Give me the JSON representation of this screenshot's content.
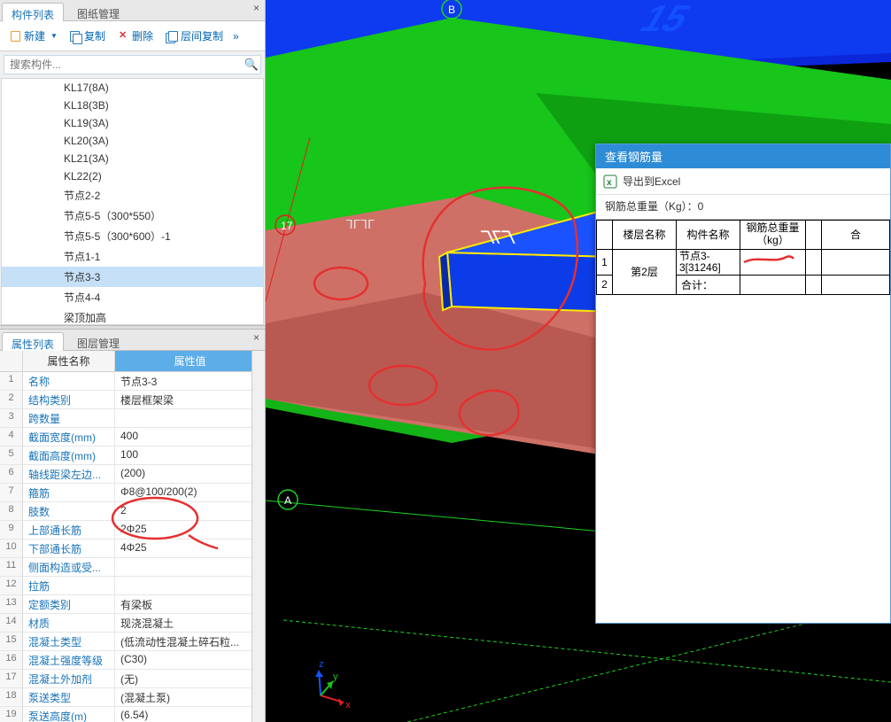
{
  "sidebar_top": {
    "close": "×",
    "tabs": [
      {
        "label": "构件列表",
        "active": true
      },
      {
        "label": "图纸管理",
        "active": false
      }
    ],
    "toolbar": {
      "new": "新建",
      "copy": "复制",
      "delete": "删除",
      "layer_copy": "层间复制"
    },
    "search_placeholder": "搜索构件...",
    "items": [
      "KL17(8A)",
      "KL18(3B)",
      "KL19(3A)",
      "KL20(3A)",
      "KL21(3A)",
      "KL22(2)",
      "节点2-2",
      "节点5-5（300*550）",
      "节点5-5（300*600）-1",
      "节点1-1",
      "节点3-3",
      "节点4-4",
      "梁顶加高"
    ],
    "selected_index": 10
  },
  "sidebar_bottom": {
    "close": "×",
    "tabs": [
      {
        "label": "属性列表",
        "active": true
      },
      {
        "label": "图层管理",
        "active": false
      }
    ],
    "header": {
      "name": "属性名称",
      "value": "属性值"
    },
    "rows": [
      {
        "idx": "1",
        "name": "名称",
        "link": true,
        "val": "节点3-3"
      },
      {
        "idx": "2",
        "name": "结构类别",
        "link": true,
        "val": "楼层框架梁"
      },
      {
        "idx": "3",
        "name": "跨数量",
        "link": true,
        "val": ""
      },
      {
        "idx": "4",
        "name": "截面宽度(mm)",
        "link": true,
        "val": "400"
      },
      {
        "idx": "5",
        "name": "截面高度(mm)",
        "link": true,
        "val": "100"
      },
      {
        "idx": "6",
        "name": "轴线距梁左边...",
        "link": true,
        "val": "(200)"
      },
      {
        "idx": "7",
        "name": "箍筋",
        "link": true,
        "val": "Φ8@100/200(2)"
      },
      {
        "idx": "8",
        "name": "肢数",
        "link": true,
        "val": "2"
      },
      {
        "idx": "9",
        "name": "上部通长筋",
        "link": true,
        "val": "2Φ25"
      },
      {
        "idx": "10",
        "name": "下部通长筋",
        "link": true,
        "val": "4Φ25"
      },
      {
        "idx": "11",
        "name": "侧面构造或受...",
        "link": true,
        "val": ""
      },
      {
        "idx": "12",
        "name": "拉筋",
        "link": true,
        "val": ""
      },
      {
        "idx": "13",
        "name": "定额类别",
        "link": true,
        "val": "有梁板"
      },
      {
        "idx": "14",
        "name": "材质",
        "link": true,
        "val": "现浇混凝土"
      },
      {
        "idx": "15",
        "name": "混凝土类型",
        "link": true,
        "val": "(低流动性混凝土碎石粒..."
      },
      {
        "idx": "16",
        "name": "混凝土强度等级",
        "link": true,
        "val": "(C30)"
      },
      {
        "idx": "17",
        "name": "混凝土外加剂",
        "link": true,
        "val": "(无)"
      },
      {
        "idx": "18",
        "name": "泵送类型",
        "link": true,
        "val": "(混凝土泵)"
      },
      {
        "idx": "19",
        "name": "泵送高度(m)",
        "link": true,
        "val": "(6.54)"
      }
    ]
  },
  "viewport_labels": {
    "axis_b": "B",
    "axis_a": "A",
    "axis_17": "17",
    "orient_x": "x",
    "orient_y": "y",
    "orient_z": "z"
  },
  "rebar_popup": {
    "title": "查看钢筋量",
    "export": "导出到Excel",
    "summary": "钢筋总重量（Kg）：0",
    "headers": {
      "floor": "楼层名称",
      "component": "构件名称",
      "weight": "钢筋总重量\n（kg）",
      "last": "合"
    },
    "rows": [
      {
        "idx": "1",
        "floor": "第2层",
        "component": "节点3-3[31246]",
        "weight": "",
        "last": ""
      },
      {
        "idx": "2",
        "floor": "",
        "component": "合计：",
        "weight": "",
        "last": ""
      }
    ]
  }
}
